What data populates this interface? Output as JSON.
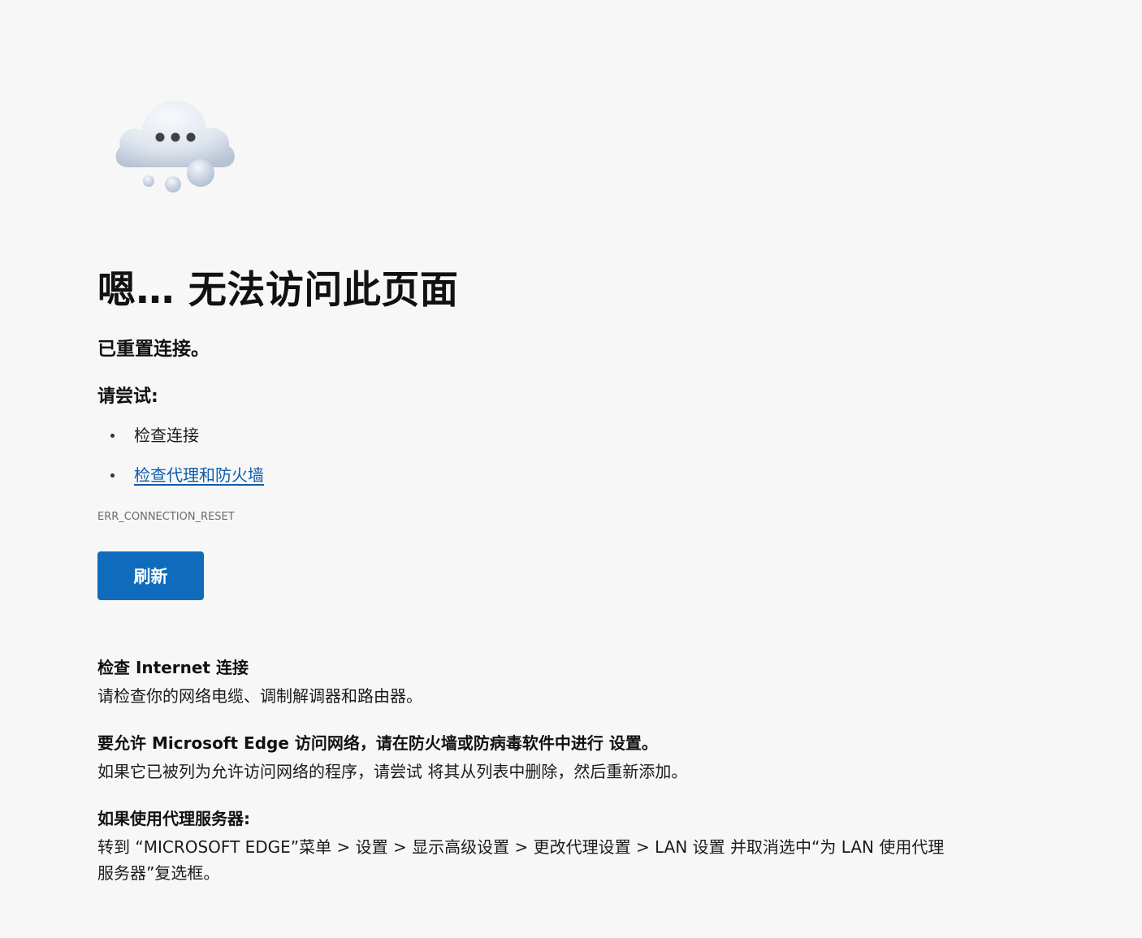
{
  "illustration": {
    "icon": "cloud-ellipsis-icon",
    "colors": {
      "cloud_light": "#f4f6fa",
      "cloud_shadow": "#b7c2d3",
      "dots": "#3f4147"
    }
  },
  "error": {
    "title": "嗯… 无法访问此页面",
    "subtitle": "已重置连接。",
    "try_label": "请尝试:",
    "suggestions": [
      {
        "label": "检查连接",
        "is_link": false
      },
      {
        "label": "检查代理和防火墙",
        "is_link": true
      }
    ],
    "code": "ERR_CONNECTION_RESET"
  },
  "actions": {
    "refresh_label": "刷新"
  },
  "help": [
    {
      "heading": "检查 Internet 连接",
      "body": "请检查你的网络电缆、调制解调器和路由器。"
    },
    {
      "heading": "要允许 Microsoft Edge 访问网络，请在防火墙或防病毒软件中进行 设置。",
      "body": "如果它已被列为允许访问网络的程序，请尝试 将其从列表中删除，然后重新添加。"
    },
    {
      "heading": "如果使用代理服务器:",
      "body": "转到 “MICROSOFT EDGE”菜单 > 设置 > 显示高级设置 > 更改代理设置 > LAN 设置 并取消选中“为 LAN 使用代理服务器”复选框。"
    }
  ],
  "colors": {
    "background": "#f7f7f7",
    "accent": "#0f6cbd",
    "link": "#0f5cab",
    "muted_text": "#6b6b6b"
  }
}
